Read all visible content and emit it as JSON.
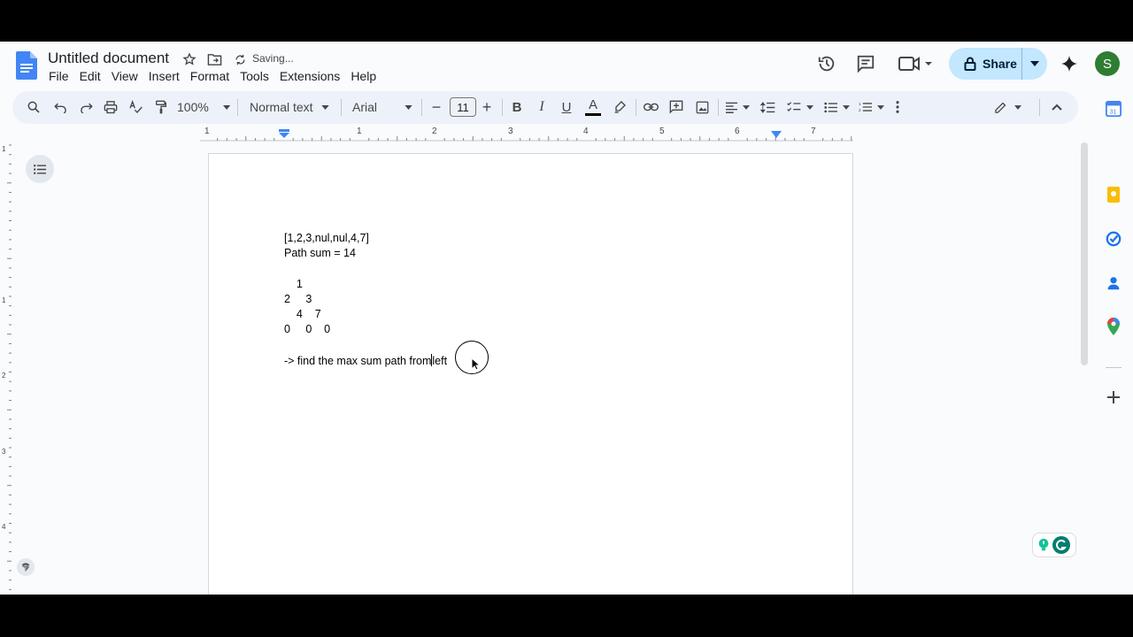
{
  "header": {
    "title": "Untitled document",
    "saving_status": "Saving...",
    "menus": [
      "File",
      "Edit",
      "View",
      "Insert",
      "Format",
      "Tools",
      "Extensions",
      "Help"
    ],
    "share_label": "Share",
    "avatar_initial": "S"
  },
  "toolbar": {
    "zoom": "100%",
    "style": "Normal text",
    "font": "Arial",
    "font_size": "11",
    "minus": "−",
    "plus": "+",
    "bold": "B",
    "italic": "I",
    "underline": "U",
    "text_color_glyph": "A"
  },
  "ruler": {
    "labels": [
      "1",
      "1",
      "2",
      "3",
      "4",
      "5",
      "6",
      "7"
    ],
    "vlabels": [
      "1",
      "1",
      "2",
      "3",
      "4"
    ]
  },
  "document": {
    "lines": [
      "[1,2,3,nul,nul,4,7]",
      "Path sum = 14",
      "    1",
      "2     3",
      "    4    7",
      "0     0    0"
    ],
    "typing_line_before_caret": "-> find the max sum path from",
    "typing_line_after_caret": "left"
  },
  "colors": {
    "accent": "#0b57d0",
    "share_bg": "#c2e7ff",
    "toolbar_bg": "#edf2fa",
    "avatar_bg": "#2e7d32",
    "text_color_bar": "#000000"
  },
  "icons": [
    "docs-logo",
    "star-icon",
    "move-folder-icon",
    "sync-icon",
    "history-icon",
    "comment-icon",
    "meet-icon",
    "lock-icon",
    "gemini-icon",
    "search-icon",
    "undo-icon",
    "redo-icon",
    "print-icon",
    "spellcheck-icon",
    "paint-format-icon",
    "highlighter-icon",
    "link-icon",
    "add-comment-icon",
    "image-icon",
    "align-left-icon",
    "line-spacing-icon",
    "checklist-icon",
    "bullet-list-icon",
    "numbered-list-icon",
    "more-vert-icon",
    "edit-mode-icon",
    "collapse-icon",
    "outline-icon",
    "calendar-icon",
    "keep-icon",
    "tasks-icon",
    "contacts-icon",
    "maps-icon",
    "add-icon",
    "fingerprint-icon",
    "chevron-right-icon"
  ]
}
